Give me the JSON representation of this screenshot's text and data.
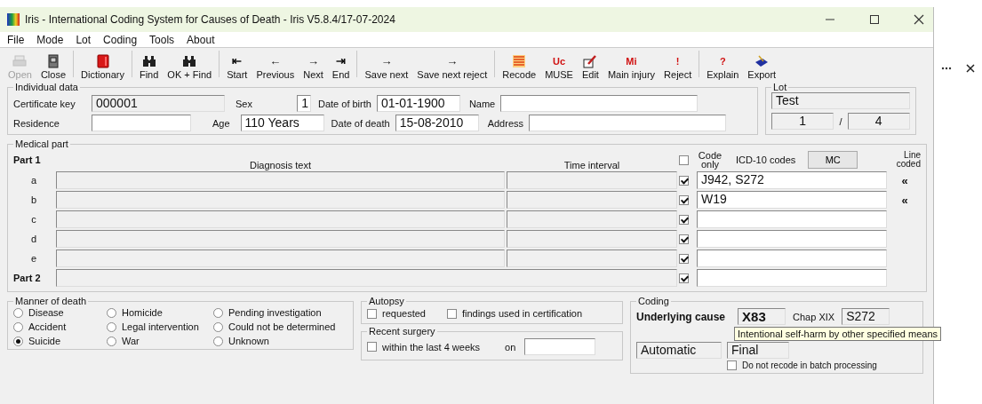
{
  "window": {
    "title": "Iris - International Coding System for Causes of Death - Iris V5.8.4/17-07-2024"
  },
  "menu": [
    "File",
    "Mode",
    "Lot",
    "Coding",
    "Tools",
    "About"
  ],
  "toolbar": [
    {
      "label": "Open",
      "disabled": true,
      "kind": "printer",
      "separator_after": false
    },
    {
      "label": "Close",
      "disabled": false,
      "kind": "door",
      "separator_after": true
    },
    {
      "label": "Dictionary",
      "disabled": false,
      "kind": "book",
      "separator_after": true
    },
    {
      "label": "Find",
      "disabled": false,
      "kind": "binoculars",
      "separator_after": false
    },
    {
      "label": "OK + Find",
      "disabled": false,
      "kind": "binoculars",
      "separator_after": true
    },
    {
      "label": "Start",
      "disabled": false,
      "kind": "glyph",
      "glyph": "⇤",
      "separator_after": false
    },
    {
      "label": "Previous",
      "disabled": false,
      "kind": "glyph",
      "glyph": "←",
      "separator_after": false
    },
    {
      "label": "Next",
      "disabled": false,
      "kind": "glyph",
      "glyph": "→",
      "separator_after": false
    },
    {
      "label": "End",
      "disabled": false,
      "kind": "glyph",
      "glyph": "⇥",
      "separator_after": true
    },
    {
      "label": "Save next",
      "disabled": false,
      "kind": "glyph",
      "glyph": "→",
      "separator_after": false
    },
    {
      "label": "Save next reject",
      "disabled": false,
      "kind": "glyph",
      "glyph": "→",
      "separator_after": true
    },
    {
      "label": "Recode",
      "disabled": false,
      "kind": "lines",
      "separator_after": false
    },
    {
      "label": "MUSE",
      "disabled": false,
      "kind": "red-glyph",
      "glyph": "Uc",
      "separator_after": false
    },
    {
      "label": "Edit",
      "disabled": false,
      "kind": "pencil",
      "separator_after": false
    },
    {
      "label": "Main injury",
      "disabled": false,
      "kind": "red-glyph",
      "glyph": "Mi",
      "separator_after": false
    },
    {
      "label": "Reject",
      "disabled": false,
      "kind": "red-glyph",
      "glyph": "!",
      "separator_after": true
    },
    {
      "label": "Explain",
      "disabled": false,
      "kind": "red-glyph",
      "glyph": "?",
      "separator_after": false
    },
    {
      "label": "Export",
      "disabled": false,
      "kind": "tray",
      "separator_after": false
    }
  ],
  "individual_data": {
    "title": "Individual data",
    "certificate_key": {
      "label": "Certificate key",
      "value": "000001"
    },
    "sex": {
      "label": "Sex",
      "value": "1"
    },
    "date_of_birth": {
      "label": "Date of birth",
      "value": "01-01-1900"
    },
    "name": {
      "label": "Name"
    },
    "residence": {
      "label": "Residence"
    },
    "age": {
      "label": "Age",
      "value": "110 Years"
    },
    "date_of_death": {
      "label": "Date of death",
      "value": "15-08-2010"
    },
    "address": {
      "label": "Address"
    }
  },
  "lot": {
    "title": "Lot",
    "name": "Test",
    "current": "1",
    "separator": "/",
    "total": "4"
  },
  "medical_part": {
    "title": "Medical part",
    "part1_label": "Part 1",
    "diagnosis_header": "Diagnosis text",
    "time_header": "Time interval",
    "code_only": {
      "label": "Code only",
      "checked": false
    },
    "codes_header": "ICD-10 codes",
    "mc_button": "MC",
    "line_coded_header": "Line coded",
    "rows": [
      {
        "label": "a",
        "checked": true,
        "codes": "J942, S272",
        "line_coded": "«"
      },
      {
        "label": "b",
        "checked": true,
        "codes": "W19",
        "line_coded": "«"
      },
      {
        "label": "c",
        "checked": true,
        "codes": "",
        "line_coded": ""
      },
      {
        "label": "d",
        "checked": true,
        "codes": "",
        "line_coded": ""
      },
      {
        "label": "e",
        "checked": true,
        "codes": "",
        "line_coded": ""
      }
    ],
    "part2": {
      "label": "Part 2",
      "checked": true
    }
  },
  "manner_of_death": {
    "title": "Manner of death",
    "options": [
      {
        "label": "Disease",
        "selected": false
      },
      {
        "label": "Homicide",
        "selected": false
      },
      {
        "label": "Pending investigation",
        "selected": false
      },
      {
        "label": "Accident",
        "selected": false
      },
      {
        "label": "Legal intervention",
        "selected": false
      },
      {
        "label": "Could not be determined",
        "selected": false
      },
      {
        "label": "Suicide",
        "selected": true
      },
      {
        "label": "War",
        "selected": false
      },
      {
        "label": "Unknown",
        "selected": false
      }
    ]
  },
  "autopsy": {
    "title": "Autopsy",
    "options": [
      {
        "label": "requested",
        "checked": false
      },
      {
        "label": "findings used in certification",
        "checked": false
      }
    ]
  },
  "recent_surgery": {
    "title": "Recent surgery",
    "option": {
      "label": "within the last 4 weeks",
      "checked": false
    },
    "on_label": "on"
  },
  "coding": {
    "title": "Coding",
    "underlying_label": "Underlying cause",
    "underlying_code": "X83",
    "chapter": "Chap XIX",
    "chapter_code": "S272",
    "mode": "Automatic",
    "status": "Final",
    "batch": {
      "label": "Do not recode in batch processing",
      "checked": false
    },
    "tooltip": "Intentional self-harm by other specified means"
  }
}
